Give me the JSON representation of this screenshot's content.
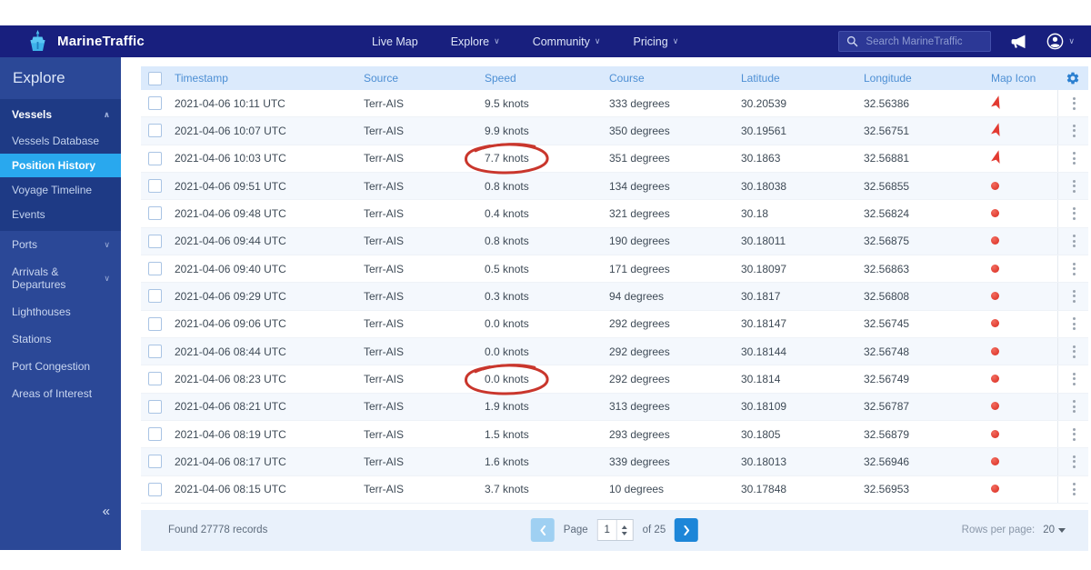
{
  "brand": {
    "name": "MarineTraffic"
  },
  "nav": {
    "items": [
      {
        "label": "Live Map",
        "dropdown": false
      },
      {
        "label": "Explore",
        "dropdown": true
      },
      {
        "label": "Community",
        "dropdown": true
      },
      {
        "label": "Pricing",
        "dropdown": true
      }
    ],
    "search_placeholder": "Search MarineTraffic",
    "icons": [
      "search-icon",
      "megaphone-icon",
      "account-icon",
      "chevron-down-icon"
    ]
  },
  "sidebar": {
    "title": "Explore",
    "items": [
      {
        "label": "Vessels",
        "type": "group-header",
        "chevron": "up"
      },
      {
        "label": "Vessels Database",
        "type": "sub",
        "active": false
      },
      {
        "label": "Position History",
        "type": "sub",
        "active": true
      },
      {
        "label": "Voyage Timeline",
        "type": "sub",
        "active": false
      },
      {
        "label": "Events",
        "type": "sub",
        "active": false
      },
      {
        "label": "Ports",
        "type": "item",
        "chevron": "down"
      },
      {
        "label": "Arrivals & Departures",
        "type": "item",
        "chevron": "down"
      },
      {
        "label": "Lighthouses",
        "type": "item",
        "chevron": ""
      },
      {
        "label": "Stations",
        "type": "item",
        "chevron": ""
      },
      {
        "label": "Port Congestion",
        "type": "item",
        "chevron": ""
      },
      {
        "label": "Areas of Interest",
        "type": "item",
        "chevron": ""
      }
    ],
    "collapse_icon": "«"
  },
  "table": {
    "columns": [
      "Timestamp",
      "Source",
      "Speed",
      "Course",
      "Latitude",
      "Longitude",
      "Map Icon"
    ],
    "rows": [
      {
        "timestamp": "2021-04-06 10:11 UTC",
        "source": "Terr-AIS",
        "speed": "9.5 knots",
        "course": "333 degrees",
        "latitude": "30.20539",
        "longitude": "32.56386",
        "icon": "arrow",
        "circled": false
      },
      {
        "timestamp": "2021-04-06 10:07 UTC",
        "source": "Terr-AIS",
        "speed": "9.9 knots",
        "course": "350 degrees",
        "latitude": "30.19561",
        "longitude": "32.56751",
        "icon": "arrow",
        "circled": false
      },
      {
        "timestamp": "2021-04-06 10:03 UTC",
        "source": "Terr-AIS",
        "speed": "7.7 knots",
        "course": "351 degrees",
        "latitude": "30.1863",
        "longitude": "32.56881",
        "icon": "arrow",
        "circled": true
      },
      {
        "timestamp": "2021-04-06 09:51 UTC",
        "source": "Terr-AIS",
        "speed": "0.8 knots",
        "course": "134 degrees",
        "latitude": "30.18038",
        "longitude": "32.56855",
        "icon": "dot",
        "circled": false
      },
      {
        "timestamp": "2021-04-06 09:48 UTC",
        "source": "Terr-AIS",
        "speed": "0.4 knots",
        "course": "321 degrees",
        "latitude": "30.18",
        "longitude": "32.56824",
        "icon": "dot",
        "circled": false
      },
      {
        "timestamp": "2021-04-06 09:44 UTC",
        "source": "Terr-AIS",
        "speed": "0.8 knots",
        "course": "190 degrees",
        "latitude": "30.18011",
        "longitude": "32.56875",
        "icon": "dot",
        "circled": false
      },
      {
        "timestamp": "2021-04-06 09:40 UTC",
        "source": "Terr-AIS",
        "speed": "0.5 knots",
        "course": "171 degrees",
        "latitude": "30.18097",
        "longitude": "32.56863",
        "icon": "dot",
        "circled": false
      },
      {
        "timestamp": "2021-04-06 09:29 UTC",
        "source": "Terr-AIS",
        "speed": "0.3 knots",
        "course": "94 degrees",
        "latitude": "30.1817",
        "longitude": "32.56808",
        "icon": "dot",
        "circled": false
      },
      {
        "timestamp": "2021-04-06 09:06 UTC",
        "source": "Terr-AIS",
        "speed": "0.0 knots",
        "course": "292 degrees",
        "latitude": "30.18147",
        "longitude": "32.56745",
        "icon": "dot",
        "circled": false
      },
      {
        "timestamp": "2021-04-06 08:44 UTC",
        "source": "Terr-AIS",
        "speed": "0.0 knots",
        "course": "292 degrees",
        "latitude": "30.18144",
        "longitude": "32.56748",
        "icon": "dot",
        "circled": false
      },
      {
        "timestamp": "2021-04-06 08:23 UTC",
        "source": "Terr-AIS",
        "speed": "0.0 knots",
        "course": "292 degrees",
        "latitude": "30.1814",
        "longitude": "32.56749",
        "icon": "dot",
        "circled": true
      },
      {
        "timestamp": "2021-04-06 08:21 UTC",
        "source": "Terr-AIS",
        "speed": "1.9 knots",
        "course": "313 degrees",
        "latitude": "30.18109",
        "longitude": "32.56787",
        "icon": "dot",
        "circled": false
      },
      {
        "timestamp": "2021-04-06 08:19 UTC",
        "source": "Terr-AIS",
        "speed": "1.5 knots",
        "course": "293 degrees",
        "latitude": "30.1805",
        "longitude": "32.56879",
        "icon": "dot",
        "circled": false
      },
      {
        "timestamp": "2021-04-06 08:17 UTC",
        "source": "Terr-AIS",
        "speed": "1.6 knots",
        "course": "339 degrees",
        "latitude": "30.18013",
        "longitude": "32.56946",
        "icon": "dot",
        "circled": false
      },
      {
        "timestamp": "2021-04-06 08:15 UTC",
        "source": "Terr-AIS",
        "speed": "3.7 knots",
        "course": "10 degrees",
        "latitude": "30.17848",
        "longitude": "32.56953",
        "icon": "dot",
        "circled": false
      }
    ]
  },
  "footer": {
    "records": "Found 27778 records",
    "page_label": "Page",
    "page_value": "1",
    "of_label": "of 25",
    "rows_per_page_label": "Rows per page:",
    "rows_per_page_value": "20"
  },
  "colors": {
    "topbar": "#181f7e",
    "sidebar": "#2b4897",
    "sidebar_group": "#1e3a85",
    "active_item": "#29a8ee",
    "header_bg": "#dbeafc",
    "header_text": "#4d8fd4",
    "row_alt": "#f4f8fd",
    "footer_bg": "#e9f1fb",
    "marker_red": "#e23a31",
    "annotation_red": "#c9362c",
    "gear_blue": "#2b7fd0"
  }
}
